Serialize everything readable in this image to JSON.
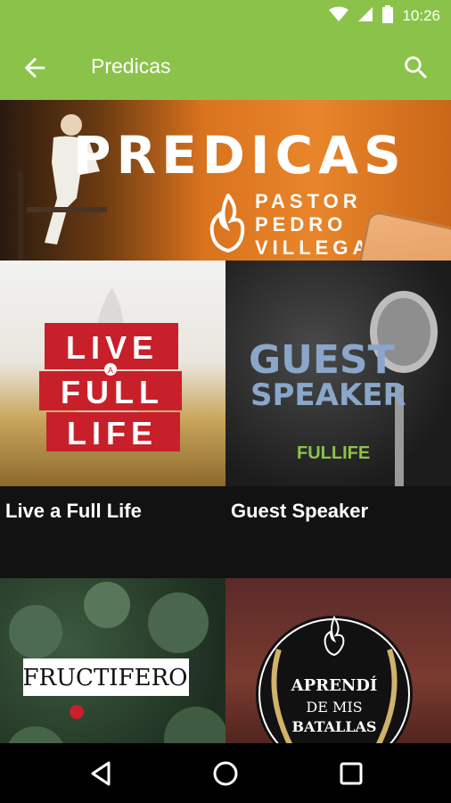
{
  "status": {
    "time": "10:26"
  },
  "appbar": {
    "title": "Predicas"
  },
  "hero": {
    "title": "PREDICAS",
    "line1": "PASTOR",
    "line2": "PEDRO",
    "line3": "VILLEGAS"
  },
  "cards": [
    {
      "label": "Live a Full Life",
      "art": [
        "LIVE",
        "A",
        "FULL",
        "LIFE"
      ]
    },
    {
      "label": "Guest Speaker",
      "art": [
        "GUEST",
        "SPEAKER",
        "FULLIFE"
      ]
    },
    {
      "label": "",
      "art": [
        "FRUCTIFERO"
      ]
    },
    {
      "label": "",
      "art": [
        "APRENDÍ",
        "DE MIS",
        "BATALLAS"
      ]
    }
  ],
  "colors": {
    "accent": "#8bc34a",
    "banner_red": "#c8202a"
  }
}
